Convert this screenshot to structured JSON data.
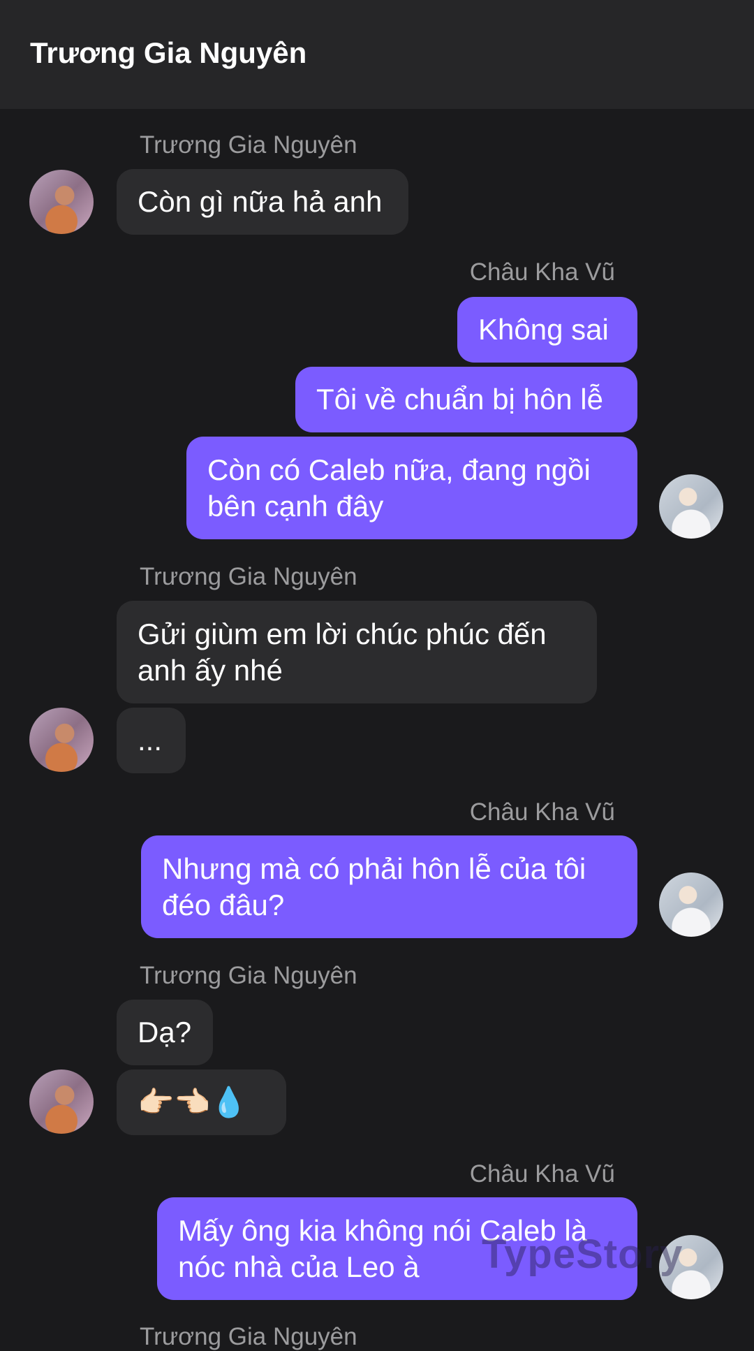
{
  "header": {
    "title": "Trương Gia Nguyên"
  },
  "messages": {
    "g1": {
      "sender": "Trương Gia Nguyên",
      "text1": "Còn gì nữa hả anh"
    },
    "g2": {
      "sender": "Châu Kha Vũ",
      "text1": "Không sai",
      "text2": "Tôi về chuẩn bị hôn lễ",
      "text3": "Còn có Caleb nữa, đang ngồi bên cạnh đây"
    },
    "g3": {
      "sender": "Trương Gia Nguyên",
      "text1": "Gửi giùm em lời chúc phúc đến anh ấy nhé",
      "text2": "..."
    },
    "g4": {
      "sender": "Châu Kha Vũ",
      "text1": "Nhưng mà có phải hôn lễ của tôi đéo đâu?"
    },
    "g5": {
      "sender": "Trương Gia Nguyên",
      "text1": "Dạ?",
      "text2": "👉🏻👈🏻💧"
    },
    "g6": {
      "sender": "Châu Kha Vũ",
      "text1": "Mấy ông kia không nói Caleb là nóc nhà của Leo à"
    },
    "g7": {
      "sender": "Trương Gia Nguyên"
    }
  },
  "watermark": "TypeStory",
  "colors": {
    "background": "#1a1a1c",
    "header": "#262628",
    "incoming": "#2c2c2e",
    "outgoing": "#7b5cff"
  }
}
